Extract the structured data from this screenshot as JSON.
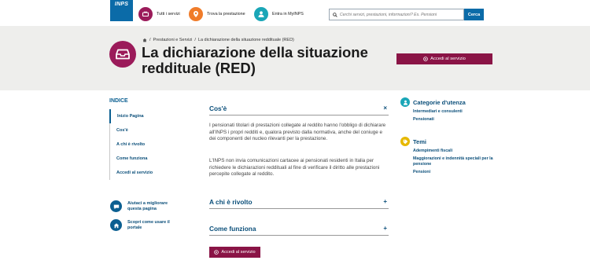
{
  "topbar": {
    "logo_text": "INPS",
    "nav": [
      {
        "label": "Tutti i servizi",
        "icon": "services-icon",
        "color": "#9b1b5a"
      },
      {
        "label": "Trova la prestazione",
        "icon": "location-pin-icon",
        "color": "#f07c2a"
      },
      {
        "label": "Entra in MyINPS",
        "icon": "user-icon",
        "color": "#1aa6b7"
      }
    ],
    "search": {
      "placeholder": "Cerchi servizi, prestazioni, informazioni? Es. Pensioni",
      "button_label": "Cerca"
    }
  },
  "header": {
    "breadcrumb": [
      "Prestazioni e Servizi",
      "La dichiarazione della situazione reddituale (RED)"
    ],
    "title": "La dichiarazione della situazione reddituale (RED)",
    "access_label": "Accedi al servizio",
    "accent_color": "#8a1446"
  },
  "index": {
    "title": "INDICE",
    "items": [
      "Inizio Pagina",
      "Cos'è",
      "A chi è rivolto",
      "Come funziona",
      "Accedi al servizio"
    ],
    "help": [
      {
        "label": "Aiutaci a migliorare questa pagina",
        "icon": "chat-icon"
      },
      {
        "label": "Scopri come usare il portale",
        "icon": "home-icon"
      }
    ]
  },
  "main": {
    "sections": [
      {
        "title": "Cos'è",
        "toggle": "×"
      },
      {
        "title": "A chi è rivolto",
        "toggle": "+"
      },
      {
        "title": "Come funziona",
        "toggle": "+"
      }
    ],
    "paragraphs": [
      "I pensionati titolari di prestazioni collegate al reddito hanno l'obbligo di dichiarare all'INPS i propri redditi e, qualora previsto dalla normativa, anche del coniuge e dei componenti del nucleo rilevanti per la prestazione.",
      "L'INPS non invia comunicazioni cartacee ai pensionati residenti in Italia per richiedere le dichiarazioni reddituali al fine di verificare il diritto alle prestazioni percepite collegate al reddito."
    ],
    "access_label": "Accedi al servizio"
  },
  "sidebar_right": {
    "categories": {
      "title": "Categorie d'utenza",
      "icon": "people-icon",
      "color": "#1aa6b7",
      "links": [
        "Intermediari e consulenti",
        "Pensionati"
      ]
    },
    "topics": {
      "title": "Temi",
      "icon": "tag-icon",
      "color": "#e6b800",
      "links": [
        "Adempimenti fiscali",
        "Maggiorazioni e indennità speciali per la pensione",
        "Pensioni"
      ]
    }
  }
}
